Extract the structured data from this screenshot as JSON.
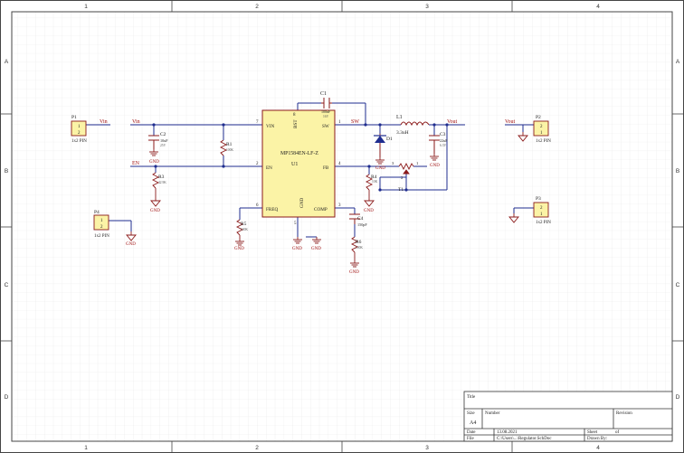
{
  "colors": {
    "wire": "#1f2d8f",
    "component": "#8b1a1a",
    "ic_fill": "#fbf3a6",
    "ic_stroke": "#8b1a1a",
    "label_blue": "#1f2d8f",
    "net_red": "#a01010",
    "grid": "#e7e7e7",
    "frame": "#333333"
  },
  "frame": {
    "columns": [
      "1",
      "2",
      "3",
      "4"
    ],
    "rows": [
      "A",
      "B",
      "C",
      "D"
    ]
  },
  "ic": {
    "name": "MP1584EN-LF-Z",
    "designator": "U1",
    "pins": {
      "vin": "VIN",
      "bst": "BST",
      "sw": "SW",
      "en": "EN",
      "fb": "FB",
      "freq": "FREQ",
      "gnd": "GND",
      "comp": "COMP"
    },
    "pin_numbers": {
      "vin": "7",
      "bst": "8",
      "sw": "1",
      "en": "2",
      "fb": "4",
      "freq": "6",
      "gnd": "5",
      "comp": "3"
    }
  },
  "nets": {
    "vin_left": "Vin",
    "vin_p1": "Vin",
    "en": "EN",
    "sw": "SW",
    "vout_right": "Vout",
    "vout_p2": "Vout"
  },
  "components": {
    "c1": {
      "ref": "C1",
      "value": "100nF",
      "extra": "16V"
    },
    "c2": {
      "ref": "C2",
      "value": "10uF",
      "extra": "25V"
    },
    "c3": {
      "ref": "C3",
      "value": "22uF",
      "extra": "6.3V"
    },
    "c4": {
      "ref": "C4",
      "value": "150pF"
    },
    "r1": {
      "ref": "R1",
      "value": "100K"
    },
    "r3": {
      "ref": "R3",
      "value": "42.9K"
    },
    "r4": {
      "ref": "R4",
      "value": "10K"
    },
    "r5": {
      "ref": "R5",
      "value": "100K"
    },
    "r6": {
      "ref": "R6",
      "value": "100K"
    },
    "l1": {
      "ref": "L1",
      "value": "3.3uH"
    },
    "d1": {
      "ref": "D1"
    },
    "t1": {
      "ref": "T1",
      "pin1": "1",
      "pin2": "2",
      "pin3": "3"
    }
  },
  "headers": {
    "p1": {
      "ref": "P1",
      "type": "1x2 PIN",
      "pin1": "1",
      "pin2": "2"
    },
    "p2": {
      "ref": "P2",
      "type": "1x2 PIN",
      "pin1": "2",
      "pin2": "1"
    },
    "p3": {
      "ref": "P3",
      "type": "1x2 PIN",
      "pin1": "2",
      "pin2": "1"
    },
    "p4": {
      "ref": "P4",
      "type": "1x2 PIN",
      "pin1": "1",
      "pin2": "2"
    }
  },
  "gnd_label": "GND",
  "title_block": {
    "title": "Title",
    "size_label": "Size",
    "size": "A4",
    "number_label": "Number",
    "revision_label": "Revision",
    "date_label": "Date",
    "date": "13.08.2021",
    "file_label": "File",
    "file": "C:\\Users\\...\\Regulator.SchDoc",
    "sheet_label": "Sheet",
    "of_label": "of",
    "drawn_label": "Drawn By:"
  }
}
